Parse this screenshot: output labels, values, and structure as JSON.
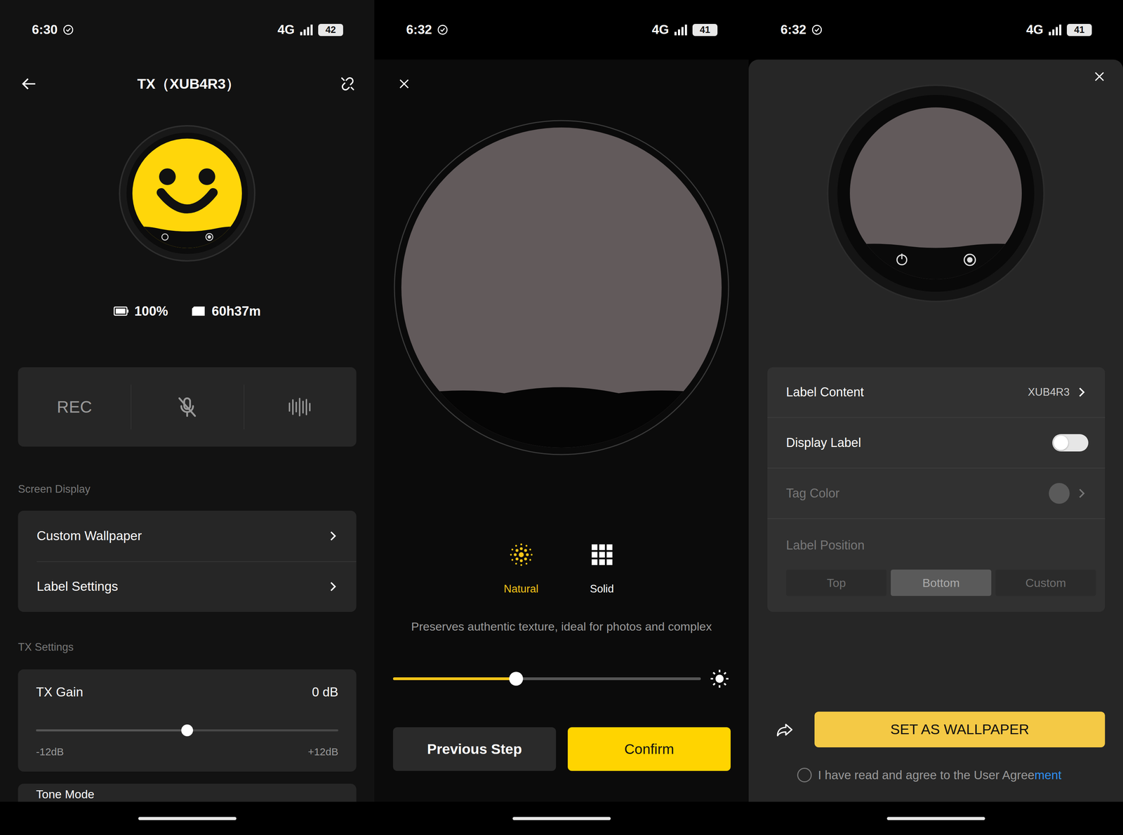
{
  "device_screen": {
    "status_bar": {
      "time": "6:30",
      "network": "4G",
      "battery": "42"
    },
    "title": "TX（XUB4R3）",
    "battery": "100%",
    "recording_time": "60h37m",
    "controls": [
      {
        "kind": "rec",
        "label": "REC"
      },
      {
        "kind": "mic-off"
      },
      {
        "kind": "waveform"
      }
    ],
    "sections": [
      {
        "title": "Screen Display",
        "items": [
          "Custom Wallpaper",
          "Label Settings"
        ]
      },
      {
        "title": "TX Settings"
      }
    ],
    "tx_gain": {
      "label": "TX Gain",
      "reading": "0 dB",
      "level": 0.5,
      "min": "-12dB",
      "max": "+12dB"
    },
    "next_item": "Tone Mode"
  },
  "wallpaper_screen": {
    "status_bar": {
      "time": "6:32",
      "network": "4G",
      "battery": "41"
    },
    "modes": [
      {
        "kind": "natural",
        "label": "Natural",
        "selected": true
      },
      {
        "kind": "solid",
        "label": "Solid",
        "selected": false
      }
    ],
    "description": "Preserves authentic texture, ideal for photos and complex",
    "brightness": {
      "level": 0.4
    },
    "buttons": [
      {
        "kind": "secondary",
        "label": "Previous Step"
      },
      {
        "kind": "primary",
        "label": "Confirm"
      }
    ]
  },
  "label_screen": {
    "status_bar": {
      "time": "6:32",
      "network": "4G",
      "battery": "41"
    },
    "rows": [
      {
        "kind": "value",
        "label": "Label Content",
        "value": "XUB4R3",
        "disabled": false
      },
      {
        "kind": "toggle",
        "label": "Display Label",
        "on": false,
        "disabled": false
      },
      {
        "kind": "color",
        "label": "Tag Color",
        "color": "#5a5a5a",
        "disabled": true
      }
    ],
    "position": {
      "label": "Label Position",
      "disabled": true,
      "options": [
        {
          "label": "Top",
          "selected": false
        },
        {
          "label": "Bottom",
          "selected": true
        },
        {
          "label": "Custom",
          "selected": false
        }
      ]
    },
    "action": {
      "label": "SET AS WALLPAPER"
    },
    "agreement": {
      "checked": false,
      "text": "I have read and agree to the User Agree",
      "link": "ment"
    }
  }
}
